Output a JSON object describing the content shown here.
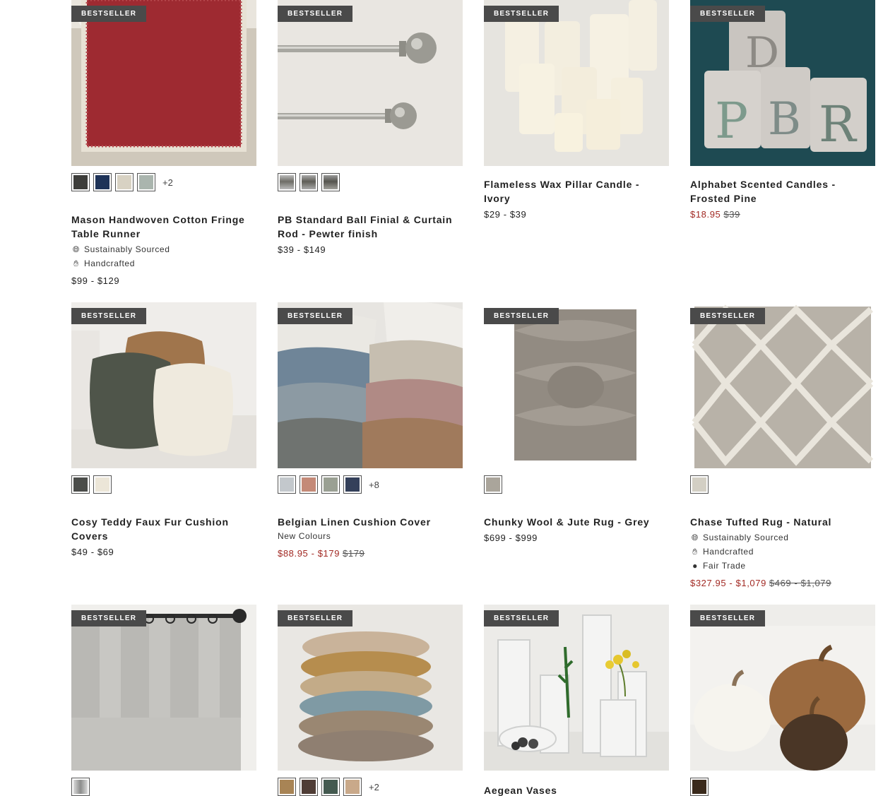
{
  "badge": "BESTSELLER",
  "products": [
    {
      "name": "Mason Handwoven Cotton Fringe Table Runner",
      "swatches": [
        "#3d3d3a",
        "#1e3358",
        "#d8d2c3",
        "#aab5ae"
      ],
      "more": "+2",
      "tags": [
        "Sustainably Sourced",
        "Handcrafted"
      ],
      "price": "$99 - $129"
    },
    {
      "name": "PB Standard Ball Finial & Curtain Rod - Pewter finish",
      "swatches": [
        "#8a8983",
        "#7a7970",
        "#6e6d66"
      ],
      "price": "$39 - $149"
    },
    {
      "name": "Flameless Wax Pillar Candle - Ivory",
      "price": "$29 - $39"
    },
    {
      "name": "Alphabet Scented Candles - Frosted Pine",
      "sale_price": "$18.95",
      "original_price": "$39"
    },
    {
      "name": "Cosy Teddy Faux Fur Cushion Covers",
      "swatches": [
        "#4b4d4a",
        "#ece6d8"
      ],
      "price": "$49 - $69"
    },
    {
      "name": "Belgian Linen Cushion Cover",
      "swatches": [
        "#c3c8cc",
        "#c48a78",
        "#9aa093",
        "#34405a"
      ],
      "more": "+8",
      "subtitle": "New Colours",
      "sale_price": "$88.95 - $179",
      "original_price": "$179"
    },
    {
      "name": "Chunky Wool & Jute Rug - Grey",
      "swatches": [
        "#aaa59b"
      ],
      "price": "$699 - $999"
    },
    {
      "name": "Chase Tufted Rug - Natural",
      "swatches": [
        "#d3cfc4"
      ],
      "tags": [
        "Sustainably Sourced",
        "Handcrafted",
        "Fair Trade"
      ],
      "sale_price": "$327.95 - $1,079",
      "original_price": "$469 - $1,079"
    },
    {
      "swatches": [
        "#9c9d9c"
      ]
    },
    {
      "swatches": [
        "#a88455",
        "#4f3d36",
        "#445a50",
        "#c9a98a"
      ],
      "more": "+2"
    },
    {
      "name": "Aegean Vases"
    },
    {
      "swatches": [
        "#3a2a1c"
      ]
    }
  ]
}
